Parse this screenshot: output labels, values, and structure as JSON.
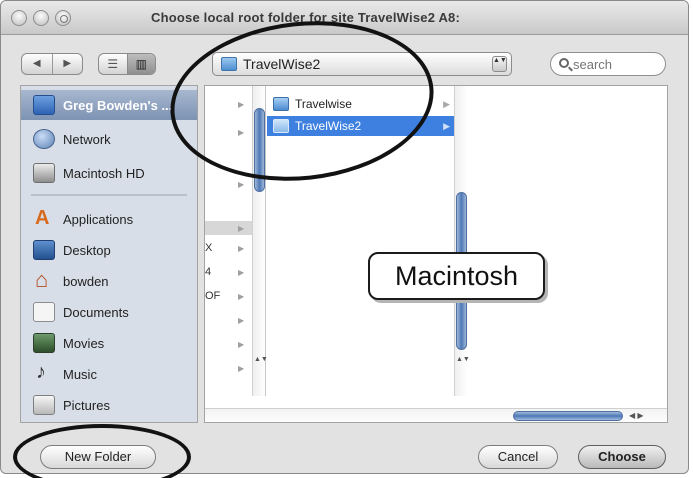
{
  "window": {
    "title": "Choose local root folder for site TravelWise2 A8:"
  },
  "toolbar": {
    "back_glyph": "◀",
    "forward_glyph": "▶",
    "view_list_glyph": "☰",
    "view_column_glyph": "▥",
    "location_popup": "TravelWise2",
    "popup_stepper_glyph": "▲▼",
    "search_placeholder": "search"
  },
  "sidebar": {
    "items": [
      {
        "label": "Greg Bowden's ...",
        "icon": "computer-icon",
        "selected": true
      },
      {
        "label": "Network",
        "icon": "network-icon"
      },
      {
        "label": "Macintosh HD",
        "icon": "hard-drive-icon"
      },
      {
        "label": "Applications",
        "icon": "applications-icon"
      },
      {
        "label": "Desktop",
        "icon": "desktop-icon"
      },
      {
        "label": "bowden",
        "icon": "home-icon"
      },
      {
        "label": "Documents",
        "icon": "documents-icon"
      },
      {
        "label": "Movies",
        "icon": "movies-icon"
      },
      {
        "label": "Music",
        "icon": "music-icon"
      },
      {
        "label": "Pictures",
        "icon": "pictures-icon"
      }
    ]
  },
  "browser": {
    "column1_fragments": [
      "X",
      "4",
      "OF"
    ],
    "column2_items": [
      {
        "label": "Travelwise",
        "selected": false
      },
      {
        "label": "TravelWise2",
        "selected": true
      }
    ],
    "scroll_arrows": "▲▼",
    "hscroll_arrows": "◀ ▶"
  },
  "buttons": {
    "new_folder": "New Folder",
    "cancel": "Cancel",
    "choose": "Choose"
  },
  "annotation": {
    "callout": "Macintosh"
  }
}
